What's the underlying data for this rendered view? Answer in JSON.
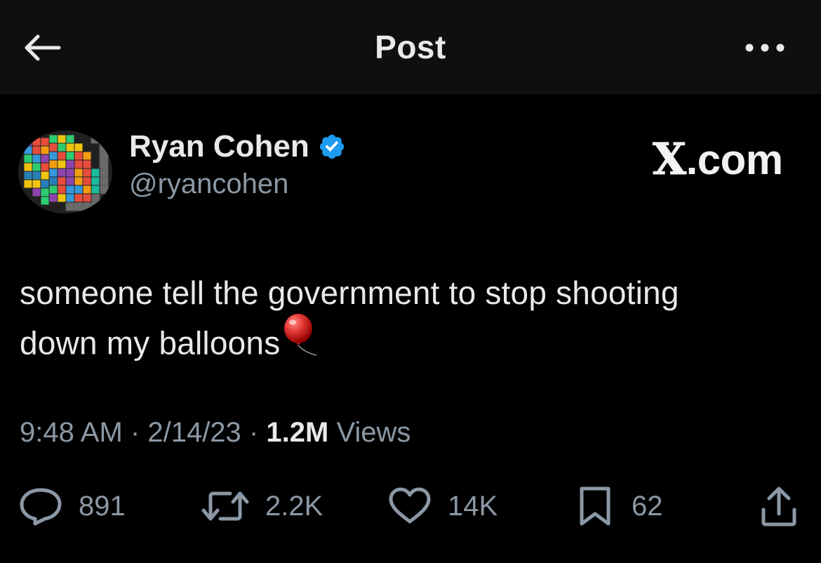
{
  "header": {
    "title": "Post",
    "back_icon": "arrow-left-icon",
    "more_icon": "more-horizontal-icon"
  },
  "author": {
    "display_name": "Ryan Cohen",
    "handle": "@ryancohen",
    "verified_icon": "verified-badge-icon",
    "verified_color": "#1d9bf0"
  },
  "watermark": {
    "x_letter": "X",
    "suffix": ".com"
  },
  "post": {
    "line1": "someone tell the government to stop shooting",
    "line2": "down my balloons",
    "emoji_icon": "balloon-icon",
    "time": "9:48 AM",
    "separator": "·",
    "date": "2/14/23",
    "views_count": "1.2M",
    "views_label": "Views"
  },
  "actions": {
    "replies": "891",
    "reposts": "2.2K",
    "likes": "14K",
    "bookmarks": "62"
  },
  "colors": {
    "background": "#000000",
    "header_background": "#0f0f0f",
    "primary_text": "#e7e9ea",
    "secondary_text": "#8b98a5",
    "accent": "#1d9bf0"
  }
}
